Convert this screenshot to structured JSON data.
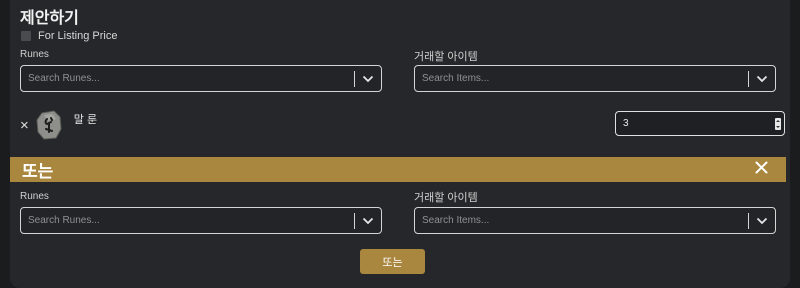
{
  "header": {
    "title": "제안하기"
  },
  "listing_price": {
    "label": "For Listing Price",
    "checked": false
  },
  "group1": {
    "runes_label": "Runes",
    "runes_placeholder": "Search Runes...",
    "items_label": "거래할 아이템",
    "items_placeholder": "Search Items..."
  },
  "selected_rune": {
    "remove_symbol": "×",
    "name": "말 룬",
    "quantity": "3"
  },
  "divider": {
    "label": "또는",
    "close_symbol": "×"
  },
  "group2": {
    "runes_label": "Runes",
    "runes_placeholder": "Search Runes...",
    "items_label": "거래할 아이템",
    "items_placeholder": "Search Items..."
  },
  "actions": {
    "or_button": "또는"
  },
  "colors": {
    "accent": "#a9873f",
    "panel": "#26272a",
    "background": "#1b1c1e"
  }
}
